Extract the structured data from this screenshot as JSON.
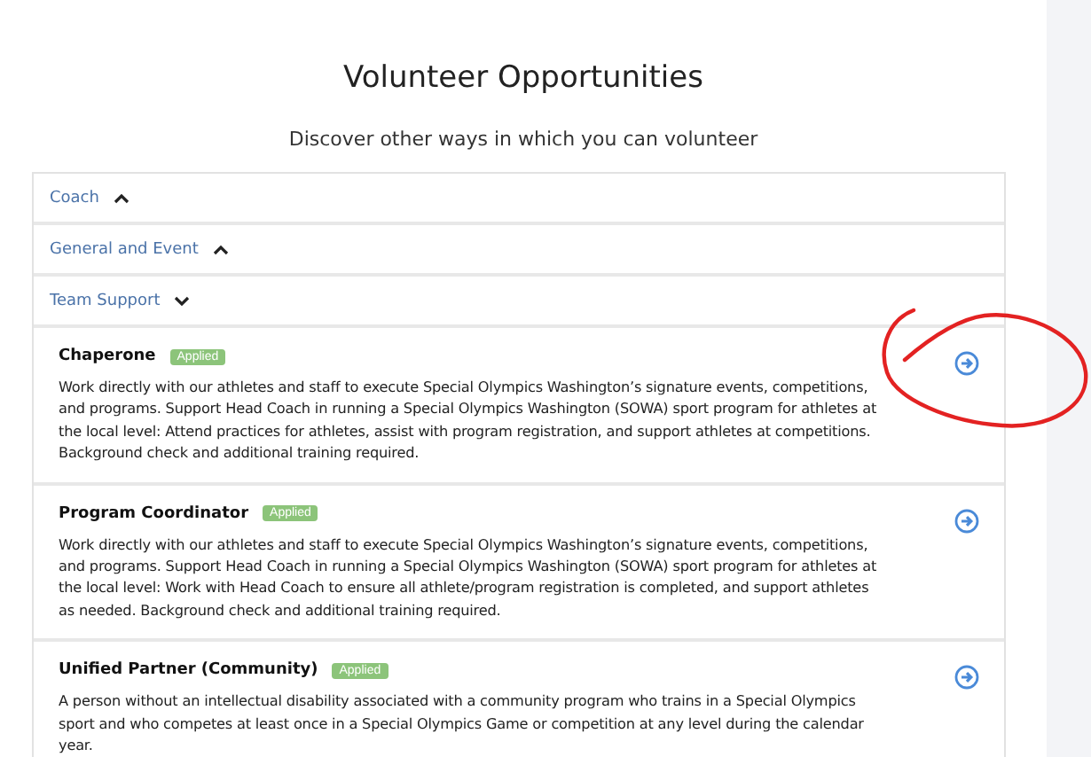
{
  "title": "Volunteer Opportunities",
  "subtitle": "Discover other ways in which you can volunteer",
  "categories": [
    {
      "label": "Coach",
      "expanded": false
    },
    {
      "label": "General and Event",
      "expanded": false
    },
    {
      "label": "Team Support",
      "expanded": true,
      "roles": [
        {
          "name": "Chaperone",
          "badge": "Applied",
          "description": "Work directly with our athletes and staff to execute Special Olympics Washington’s signature events, competitions, and programs. Support Head Coach in running a Special Olympics Washington (SOWA) sport program for athletes at the local level: Attend practices for athletes, assist with program registration, and support athletes at competitions. Background check and additional training required."
        },
        {
          "name": "Program Coordinator",
          "badge": "Applied",
          "description": "Work directly with our athletes and staff to execute Special Olympics Washington’s signature events, competitions, and programs. Support Head Coach in running a Special Olympics Washington (SOWA) sport program for athletes at the local level: Work with Head Coach to ensure all athlete/program registration is completed, and support athletes as needed. Background check and additional training required."
        },
        {
          "name": "Unified Partner (Community)",
          "badge": "Applied",
          "description": "A person without an intellectual disability associated with a community program who trains in a Special Olympics sport and who competes at least once in a Special Olympics Game or competition at any level during the calendar year."
        }
      ]
    }
  ]
}
